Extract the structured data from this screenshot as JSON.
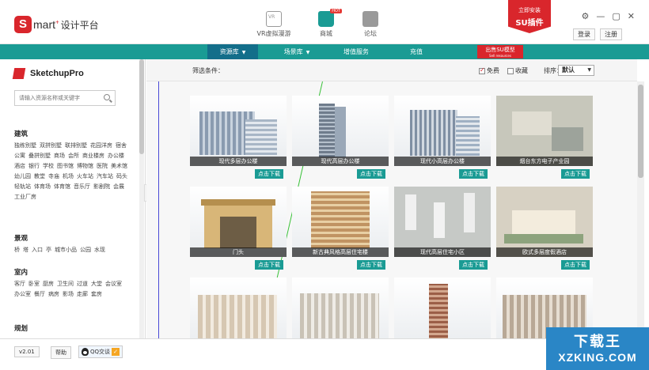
{
  "app": {
    "logo_letter": "S",
    "logo_word": "mart",
    "logo_plus": "+",
    "logo_cn": "设计平台"
  },
  "top_nav": [
    {
      "label": "VR虚拟漫游",
      "icon": "vr-icon"
    },
    {
      "label": "商城",
      "icon": "shop-bag-icon",
      "badge": "HOT"
    },
    {
      "label": "论坛",
      "icon": "forum-icon"
    }
  ],
  "su_badge": {
    "line1": "立即安装",
    "line2": "SU插件"
  },
  "window": {
    "settings": "⚙",
    "minimize": "—",
    "maximize": "▢",
    "close": "✕"
  },
  "auth": {
    "login": "登录",
    "register": "注册"
  },
  "menu": [
    {
      "label": "资源库",
      "has_arrow": true,
      "active": true
    },
    {
      "label": "场景库",
      "has_arrow": true,
      "active": false
    },
    {
      "label": "增值服务",
      "has_arrow": false,
      "active": false
    },
    {
      "label": "充值",
      "has_arrow": false,
      "active": false
    }
  ],
  "buy_su": {
    "label": "出售SU模型",
    "sub": "Sell resources"
  },
  "sidebar": {
    "brand": "SketchupPro",
    "search_placeholder": "请输入资源名称或关键字",
    "categories": [
      {
        "title": "建筑",
        "items": [
          "独栋别墅",
          "双拼别墅",
          "联排别墅",
          "花园洋房",
          "宿舍",
          "公寓",
          "叠拼别墅",
          "商场",
          "会所",
          "商业楼房",
          "办公楼",
          "酒店",
          "银行",
          "学校",
          "图书馆",
          "博物馆",
          "医院",
          "美术馆",
          "幼儿园",
          "教堂",
          "寺庙",
          "机场",
          "火车站",
          "汽车站",
          "码头",
          "轻轨站",
          "体育场",
          "体育馆",
          "音乐厅",
          "影剧院",
          "会展",
          "工业厂房"
        ]
      },
      {
        "title": "景观",
        "items": [
          "桥",
          "塔",
          "入口",
          "亭",
          "城市小品",
          "公园",
          "水现"
        ]
      },
      {
        "title": "室内",
        "items": [
          "客厅",
          "卧室",
          "厨房",
          "卫生间",
          "过道",
          "大堂",
          "会议室",
          "办公室",
          "餐厅",
          "病房",
          "影场",
          "走廊",
          "套房"
        ]
      },
      {
        "title": "规划",
        "items": []
      }
    ]
  },
  "filter": {
    "label": "筛选条件：",
    "free": "免费",
    "favorite": "收藏",
    "free_checked": true,
    "favorite_checked": false,
    "sort_label": "排序：",
    "sort_value": "默认"
  },
  "models": [
    {
      "name": "现代多层办公楼",
      "download": "点击下载"
    },
    {
      "name": "现代高层办公楼",
      "download": "点击下载"
    },
    {
      "name": "现代小高层办公楼",
      "download": "点击下载"
    },
    {
      "name": "烟台东方电子产业园",
      "download": "点击下载"
    },
    {
      "name": "门头",
      "download": "点击下载"
    },
    {
      "name": "新古典风格高层住宅楼",
      "download": "点击下载"
    },
    {
      "name": "现代高层住宅小区",
      "download": "点击下载"
    },
    {
      "name": "欧式多层度假酒店",
      "download": "点击下载"
    },
    {
      "name": "",
      "download": ""
    },
    {
      "name": "",
      "download": ""
    },
    {
      "name": "",
      "download": ""
    },
    {
      "name": "",
      "download": ""
    }
  ],
  "footer": {
    "version": "v2.01",
    "help": "帮助",
    "qq": "QQ交谈"
  },
  "watermark": {
    "cn": "下载王",
    "en": "XZKING.COM"
  },
  "colors": {
    "brand_red": "#d9262c",
    "teal": "#1a9b94",
    "menu_active": "#136e8a",
    "watermark_blue": "#2a86c6"
  }
}
